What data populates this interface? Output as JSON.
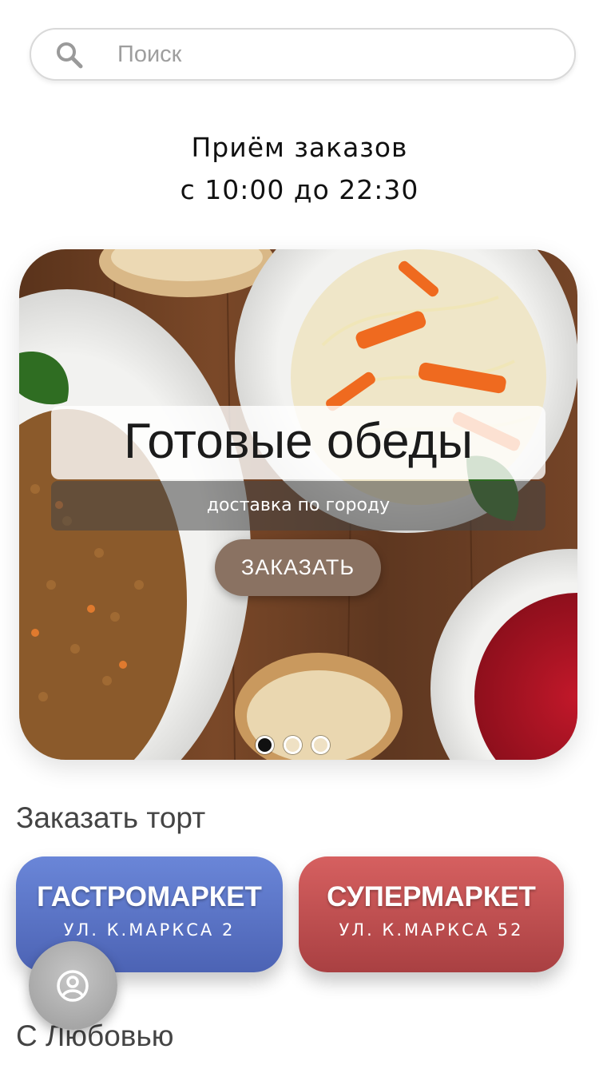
{
  "search": {
    "placeholder": "Поиск",
    "icon": "search-icon"
  },
  "hours": {
    "line1": "Приём заказов",
    "line2": "с 10:00 до 22:30"
  },
  "banner": {
    "title": "Готовые обеды",
    "subtitle": "доставка по городу",
    "button": "ЗАКАЗАТЬ",
    "slide_count": 3,
    "active_slide": 1
  },
  "cakes": {
    "title": "Заказать торт",
    "stores": [
      {
        "name": "ГАСТРОМАРКЕТ",
        "address": "УЛ. К.МАРКСА 2",
        "color": "#5b75c8"
      },
      {
        "name": "СУПЕРМАРКЕТ",
        "address": "УЛ. К.МАРКСА 52",
        "color": "#c04f51"
      }
    ]
  },
  "next_section": {
    "title": "С Любовью"
  },
  "fab": {
    "icon": "user-profile-icon"
  },
  "colors": {
    "order_button": "#8a7262",
    "wood": "#6b3f22"
  }
}
